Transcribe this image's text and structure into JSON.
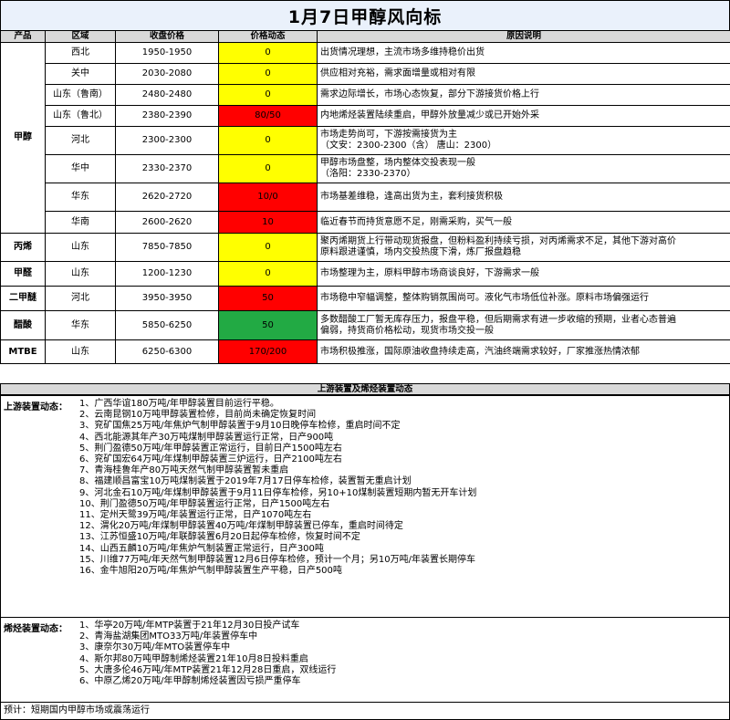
{
  "title": "1月7日甲醇风向标",
  "columns": {
    "product": "产品",
    "region": "区域",
    "price": "收盘价格",
    "change": "价格动态",
    "reason": "原因说明"
  },
  "rows": [
    {
      "region": "西北",
      "price": "1950-1950",
      "change": "0",
      "color": "#ffff00",
      "reason": "出货情况理想，主流市场多维持稳价出货"
    },
    {
      "region": "关中",
      "price": "2030-2080",
      "change": "0",
      "color": "#ffff00",
      "reason": "供应相对充裕，需求面增量或相对有限"
    },
    {
      "region": "山东（鲁南）",
      "price": "2480-2480",
      "change": "0",
      "color": "#ffff00",
      "reason": "需求边际增长，市场心态恢复，部分下游接货价格上行"
    },
    {
      "region": "山东（鲁北）",
      "price": "2380-2390",
      "change": "80/50",
      "color": "#ff0000",
      "reason": "内地烯烃装置陆续重启，甲醇外放量减少或已开始外采"
    },
    {
      "region": "河北",
      "price": "2300-2300",
      "change": "0",
      "color": "#ffff00",
      "reason": "市场走势尚可，下游按需接货为主",
      "reason2": "（文安：2300-2300（含） 唐山：2300）"
    },
    {
      "region": "华中",
      "price": "2330-2370",
      "change": "0",
      "color": "#ffff00",
      "reason": "甲醇市场盘整，场内整体交投表现一般",
      "reason2": "（洛阳：2330-2370）"
    },
    {
      "region": "华东",
      "price": "2620-2720",
      "change": "10/0",
      "color": "#ff0000",
      "reason": "市场基差维稳，逢高出货为主，套利接货积极"
    },
    {
      "region": "华南",
      "price": "2600-2620",
      "change": "10",
      "color": "#ff0000",
      "reason": "临近春节而持货意愿不足，刚需采购，买气一般"
    }
  ],
  "methanol_label": "甲醇",
  "others": [
    {
      "product": "丙烯",
      "region": "山东",
      "price": "7850-7850",
      "change": "0",
      "color": "#ffff00",
      "reason": "聚丙烯期货上行带动现货报盘，但粉料盈利持续亏损，对丙烯需求不足，其他下游对高价",
      "reason2": "原料跟进谨慎，场内交投热度下滑，炼厂报盘趋稳"
    },
    {
      "product": "甲醛",
      "region": "山东",
      "price": "1200-1230",
      "change": "0",
      "color": "#ffff00",
      "reason": "市场整理为主，原料甲醇市场商谈良好，下游需求一般"
    },
    {
      "product": "二甲醚",
      "region": "河北",
      "price": "3950-3950",
      "change": "50",
      "color": "#ff0000",
      "reason": "市场稳中窄幅调整，整体购销氛围尚可。液化气市场低位补涨。原料市场偏强运行"
    },
    {
      "product": "醋酸",
      "region": "华东",
      "price": "5850-6250",
      "change": "50",
      "color": "#22aa44",
      "reason": "多数醋酸工厂暂无库存压力，报盘平稳，但后期需求有进一步收缩的预期，业者心态普遍",
      "reason2": "偏弱，持货商价格松动，现货市场交投一般"
    },
    {
      "product": "MTBE",
      "region": "山东",
      "price": "6250-6300",
      "change": "170/200",
      "color": "#ff0000",
      "reason": "市场积极推涨，国际原油收盘持续走高，汽油终端需求较好，厂家推涨热情浓郁"
    }
  ],
  "section_title": "上游装置及烯烃装置动态",
  "upstream": {
    "head": "上游装置动态：",
    "items": [
      "1、广西华谊180万吨/年甲醇装置目前运行平稳。",
      "2、云南昆钢10万吨甲醇装置检修，目前尚未确定恢复时间",
      "3、兖矿国焦25万吨/年焦炉气制甲醇装置于9月10日晚停车检修，重启时间不定",
      "4、西北能源其年产30万吨煤制甲醇装置运行正常，日产900吨",
      "5、荆门盈德50万吨/年甲醇装置正常运行，目前日产1500吨左右",
      "6、兖矿国宏64万吨/年煤制甲醇装置三炉运行，日产2100吨左右",
      "7、青海桂鲁年产80万吨天然气制甲醇装置暂未重启",
      "8、福建顺昌富宝10万吨煤制装置于2019年7月17日停车检修，装置暂无重启计划",
      "9、河北金石10万吨/年煤制甲醇装置于9月11日停车检修，另10+10煤制装置短期内暂无开车计划",
      "10、荆门盈德50万吨/年甲醇装置运行正常，日产1500吨左右",
      "11、定州天鹭39万吨/年装置运行正常，日产1070吨左右",
      "12、渭化20万吨/年煤制甲醇装置40万吨/年煤制甲醇装置已停车，重启时间待定",
      "13、江苏恒盛10万吨/年联醇装置6月20日起停车检修，恢复时间不定",
      "14、山西五麟10万吨/年焦炉气制装置正常运行，日产300吨",
      "15、川维77万吨/年天然气制甲醇装置12月6日停车检修，预计一个月；另10万吨/年装置长期停车",
      "16、金牛旭阳20万吨/年焦炉气制甲醇装置生产平稳，日产500吨"
    ]
  },
  "olefin": {
    "head": "烯烃装置动态：",
    "items": [
      "1、华亭20万吨/年MTP装置于21年12月30日投产试车",
      "2、青海盐湖集团MTO33万吨/年装置停车中",
      "3、康奈尔30万吨/年MTO装置停车中",
      "4、斯尔邦80万吨甲醇制烯烃装置21年10月8日投料重启",
      "5、大唐多伦46万吨/年MTP装置21年12月28日重启，双线运行",
      "6、中原乙烯20万吨/年甲醇制烯烃装置因亏损严重停车"
    ]
  },
  "forecast": "预计：短期国内甲醇市场或震荡运行"
}
